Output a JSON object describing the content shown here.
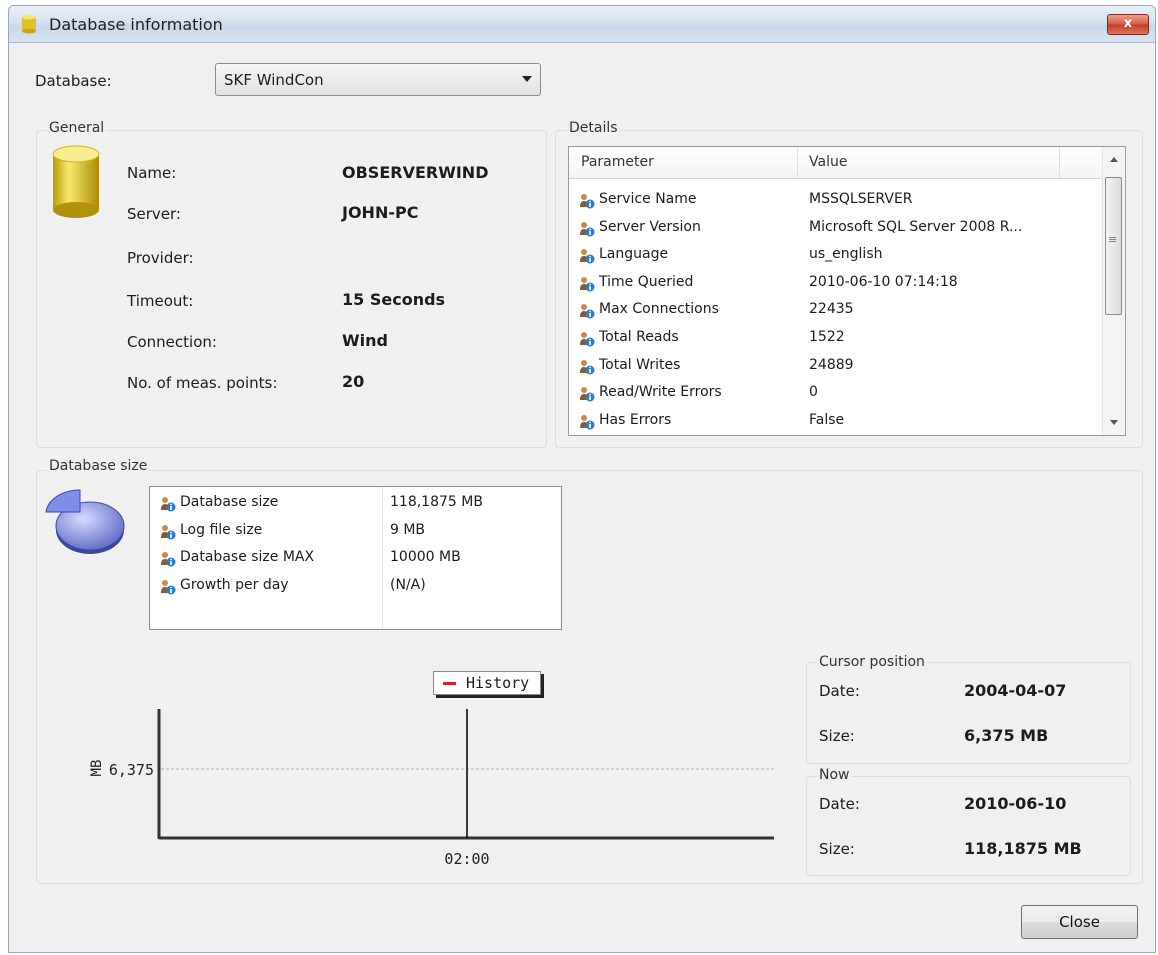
{
  "window": {
    "title": "Database information",
    "close_glyph": "x"
  },
  "database_selector": {
    "label": "Database:",
    "value": "SKF WindCon"
  },
  "general": {
    "title": "General",
    "rows": [
      {
        "label": "Name:",
        "value": "OBSERVERWIND"
      },
      {
        "label": "Server:",
        "value": "JOHN-PC"
      },
      {
        "label": "Provider:",
        "value": ""
      },
      {
        "label": "Timeout:",
        "value": "15 Seconds"
      },
      {
        "label": "Connection:",
        "value": "Wind"
      },
      {
        "label": "No. of meas. points:",
        "value": "20"
      }
    ]
  },
  "details": {
    "title": "Details",
    "columns": [
      "Parameter",
      "Value"
    ],
    "rows": [
      {
        "parameter": "Service Name",
        "value": "MSSQLSERVER"
      },
      {
        "parameter": "Server Version",
        "value": "Microsoft SQL Server 2008 R..."
      },
      {
        "parameter": "Language",
        "value": "us_english"
      },
      {
        "parameter": "Time Queried",
        "value": "2010-06-10 07:14:18"
      },
      {
        "parameter": "Max Connections",
        "value": "22435"
      },
      {
        "parameter": "Total Reads",
        "value": "1522"
      },
      {
        "parameter": "Total Writes",
        "value": "24889"
      },
      {
        "parameter": "Read/Write Errors",
        "value": "0"
      },
      {
        "parameter": "Has Errors",
        "value": "False"
      }
    ],
    "scrollbar_grip": "≡"
  },
  "database_size": {
    "title": "Database size",
    "rows": [
      {
        "parameter": "Database size",
        "value": "118,1875 MB"
      },
      {
        "parameter": "Log file size",
        "value": "9 MB"
      },
      {
        "parameter": "Database size MAX",
        "value": "10000 MB"
      },
      {
        "parameter": "Growth per day",
        "value": "(N/A)"
      }
    ]
  },
  "chart_data": {
    "type": "line",
    "series": [
      {
        "name": "History",
        "color": "#e0201f",
        "values": []
      }
    ],
    "ylabel": "MB",
    "y_ticks": [
      "6,375"
    ],
    "x_ticks": [
      "02:00"
    ],
    "cursor_x": "02:00",
    "grid": false,
    "reference_line": "6,375",
    "legend": "top"
  },
  "cursor_position": {
    "title": "Cursor position",
    "date_label": "Date:",
    "date_value": "2004-04-07",
    "size_label": "Size:",
    "size_value": "6,375 MB"
  },
  "now": {
    "title": "Now",
    "date_label": "Date:",
    "date_value": "2010-06-10",
    "size_label": "Size:",
    "size_value": "118,1875 MB"
  },
  "buttons": {
    "close": "Close"
  },
  "icons": {
    "title": "database-icon",
    "general": "database-cylinder-icon",
    "size": "pie-chart-icon",
    "row": "info-person-icon"
  }
}
